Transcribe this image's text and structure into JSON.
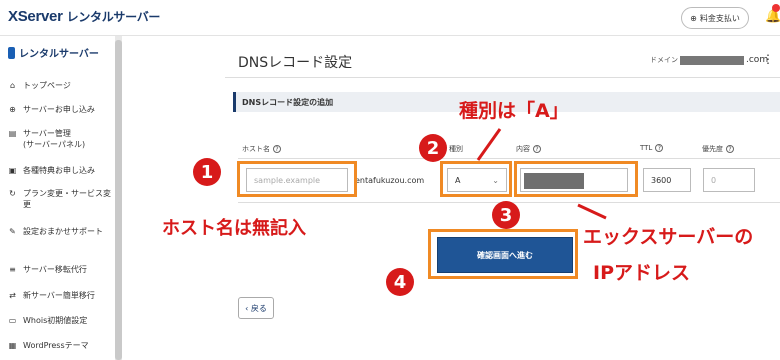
{
  "header": {
    "logo_main": "XServer",
    "logo_sub": "レンタルサーバー",
    "pay_label": "料金支払い"
  },
  "sidebar": {
    "title": "レンタルサーバー",
    "items": [
      {
        "label": "トップページ",
        "icon": "home-icon"
      },
      {
        "label": "サーバーお申し込み",
        "icon": "plus-icon"
      },
      {
        "label": "サーバー管理\n(サーバーパネル)",
        "icon": "server-icon"
      },
      {
        "label": "各種特典お申し込み",
        "icon": "gift-icon"
      },
      {
        "label": "プラン変更・サービス変更",
        "icon": "refresh-icon"
      },
      {
        "label": "設定おまかせサポート",
        "icon": "wrench-icon"
      },
      {
        "label": "サーバー移転代行",
        "icon": "list-icon"
      },
      {
        "label": "新サーバー簡単移行",
        "icon": "move-icon"
      },
      {
        "label": "Whois初期値設定",
        "icon": "doc-icon"
      },
      {
        "label": "WordPressテーマ",
        "icon": "layout-icon"
      }
    ]
  },
  "main": {
    "title": "DNSレコード設定",
    "domain_prefix": "ドメイン",
    "domain_suffix": ".com",
    "section_title": "DNSレコード設定の追加",
    "columns": {
      "host": "ホスト名",
      "type": "種別",
      "content": "内容",
      "ttl": "TTL",
      "priority": "優先度"
    },
    "host_placeholder": "sample.example",
    "host_suffix": "entafukuzou.com",
    "type_value": "A",
    "ttl_value": "3600",
    "priority_placeholder": "0",
    "confirm_label": "確認画面へ進む",
    "back_label": "‹ 戻る"
  },
  "annotations": {
    "n1": "1",
    "n2": "2",
    "n3": "3",
    "n4": "4",
    "type_note": "種別は「A」",
    "host_note": "ホスト名は無記入",
    "ip_note_1": "エックスサーバーの",
    "ip_note_2": "IPアドレス",
    "accent_color": "#d71a1a",
    "box_color": "#f08a24"
  }
}
